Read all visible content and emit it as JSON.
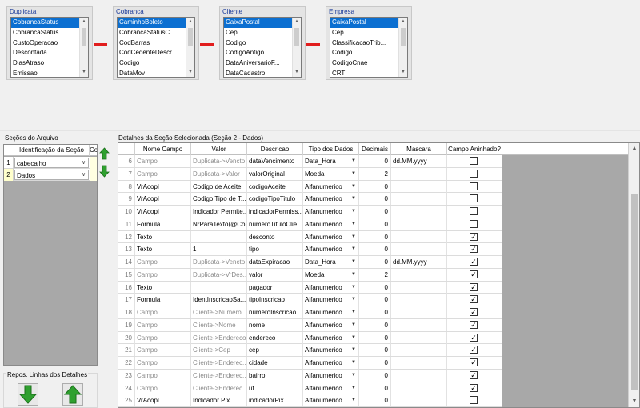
{
  "entities": [
    {
      "title": "Duplicata",
      "items": [
        "CobrancaStatus",
        "CobrancaStatus...",
        "CustoOperacao",
        "Descontada",
        "DiasAtraso",
        "Emissao"
      ]
    },
    {
      "title": "Cobranca",
      "items": [
        "CaminhoBoleto",
        "CobrancaStatusC...",
        "CodBarras",
        "CodCedenteDescr",
        "Codigo",
        "DataMov"
      ]
    },
    {
      "title": "Cliente",
      "items": [
        "CaixaPostal",
        "Cep",
        "Codigo",
        "CodigoAntigo",
        "DataAniversarioF...",
        "DataCadastro"
      ]
    },
    {
      "title": "Empresa",
      "items": [
        "CaixaPostal",
        "Cep",
        "ClassificacaoTrib...",
        "Codigo",
        "CodigoCnae",
        "CRT"
      ]
    }
  ],
  "sections": {
    "label": "Seções do Arquivo",
    "header": "Identificação da Seção",
    "header2": "Co",
    "rows": [
      {
        "num": "1",
        "value": "cabecalho"
      },
      {
        "num": "2",
        "value": "Dados"
      }
    ]
  },
  "repos": {
    "label": "Repos. Linhas dos Detalhes"
  },
  "details": {
    "label": "Detalhes da Seção Selecionada (Seção 2 - Dados)",
    "columns": [
      "Nome Campo",
      "Valor",
      "Descricao",
      "Tipo dos Dados",
      "Decimais",
      "Mascara",
      "Campo Aninhado?"
    ],
    "rows": [
      {
        "num": "6",
        "nome": "Campo",
        "valor": "Duplicata->Vencto",
        "descricao": "dataVencimento",
        "tipo": "Data_Hora",
        "decimais": "0",
        "mascara": "dd.MM.yyyy",
        "aninhado": false,
        "gray": true
      },
      {
        "num": "7",
        "nome": "Campo",
        "valor": "Duplicata->Valor",
        "descricao": "valorOriginal",
        "tipo": "Moeda",
        "decimais": "2",
        "mascara": "",
        "aninhado": false,
        "gray": true
      },
      {
        "num": "8",
        "nome": "VrAcopl",
        "valor": "Codigo de Aceite",
        "descricao": "codigoAceite",
        "tipo": "Alfanumerico",
        "decimais": "0",
        "mascara": "",
        "aninhado": false,
        "gray": false
      },
      {
        "num": "9",
        "nome": "VrAcopl",
        "valor": "Codigo Tipo de T...",
        "descricao": "codigoTipoTitulo",
        "tipo": "Alfanumerico",
        "decimais": "0",
        "mascara": "",
        "aninhado": false,
        "gray": false
      },
      {
        "num": "10",
        "nome": "VrAcopl",
        "valor": "Indicador Permite...",
        "descricao": "indicadorPermiss...",
        "tipo": "Alfanumerico",
        "decimais": "0",
        "mascara": "",
        "aninhado": false,
        "gray": false
      },
      {
        "num": "11",
        "nome": "Formula",
        "valor": "NrParaTexto(@Co...",
        "descricao": "numeroTituloClie...",
        "tipo": "Alfanumerico",
        "decimais": "0",
        "mascara": "",
        "aninhado": false,
        "gray": false
      },
      {
        "num": "12",
        "nome": "Texto",
        "valor": "",
        "descricao": "desconto",
        "tipo": "Alfanumerico",
        "decimais": "0",
        "mascara": "",
        "aninhado": true,
        "gray": false
      },
      {
        "num": "13",
        "nome": "Texto",
        "valor": "1",
        "descricao": "tipo",
        "tipo": "Alfanumerico",
        "decimais": "0",
        "mascara": "",
        "aninhado": true,
        "gray": false
      },
      {
        "num": "14",
        "nome": "Campo",
        "valor": "Duplicata->Vencto",
        "descricao": "dataExpiracao",
        "tipo": "Data_Hora",
        "decimais": "0",
        "mascara": "dd.MM.yyyy",
        "aninhado": true,
        "gray": true
      },
      {
        "num": "15",
        "nome": "Campo",
        "valor": "Duplicata->VrDes...",
        "descricao": "valor",
        "tipo": "Moeda",
        "decimais": "2",
        "mascara": "",
        "aninhado": true,
        "gray": true
      },
      {
        "num": "16",
        "nome": "Texto",
        "valor": "",
        "descricao": "pagador",
        "tipo": "Alfanumerico",
        "decimais": "0",
        "mascara": "",
        "aninhado": true,
        "gray": false
      },
      {
        "num": "17",
        "nome": "Formula",
        "valor": "IdentInscricaoSa...",
        "descricao": "tipoInscricao",
        "tipo": "Alfanumerico",
        "decimais": "0",
        "mascara": "",
        "aninhado": true,
        "gray": false
      },
      {
        "num": "18",
        "nome": "Campo",
        "valor": "Cliente->Numero...",
        "descricao": "numeroInscricao",
        "tipo": "Alfanumerico",
        "decimais": "0",
        "mascara": "",
        "aninhado": true,
        "gray": true
      },
      {
        "num": "19",
        "nome": "Campo",
        "valor": "Cliente->Nome",
        "descricao": "nome",
        "tipo": "Alfanumerico",
        "decimais": "0",
        "mascara": "",
        "aninhado": true,
        "gray": true
      },
      {
        "num": "20",
        "nome": "Campo",
        "valor": "Cliente->Endereco",
        "descricao": "endereco",
        "tipo": "Alfanumerico",
        "decimais": "0",
        "mascara": "",
        "aninhado": true,
        "gray": true
      },
      {
        "num": "21",
        "nome": "Campo",
        "valor": "Cliente->Cep",
        "descricao": "cep",
        "tipo": "Alfanumerico",
        "decimais": "0",
        "mascara": "",
        "aninhado": true,
        "gray": true
      },
      {
        "num": "22",
        "nome": "Campo",
        "valor": "Cliente->Enderec...",
        "descricao": "cidade",
        "tipo": "Alfanumerico",
        "decimais": "0",
        "mascara": "",
        "aninhado": true,
        "gray": true
      },
      {
        "num": "23",
        "nome": "Campo",
        "valor": "Cliente->Enderec...",
        "descricao": "bairro",
        "tipo": "Alfanumerico",
        "decimais": "0",
        "mascara": "",
        "aninhado": true,
        "gray": true
      },
      {
        "num": "24",
        "nome": "Campo",
        "valor": "Cliente->Enderec...",
        "descricao": "uf",
        "tipo": "Alfanumerico",
        "decimais": "0",
        "mascara": "",
        "aninhado": true,
        "gray": true
      },
      {
        "num": "25",
        "nome": "VrAcopl",
        "valor": "Indicador Pix",
        "descricao": "indicadorPix",
        "tipo": "Alfanumerico",
        "decimais": "0",
        "mascara": "",
        "aninhado": false,
        "gray": false
      }
    ]
  },
  "colors": {
    "selection": "#0b6fd1",
    "link": "#e11d1d",
    "green_arrow": "#2fa02f",
    "title_blue": "#1a3a9a"
  },
  "icons": [
    "arrow-down-green-icon",
    "arrow-up-green-icon",
    "checkbox-icon",
    "dropdown-arrow-icon"
  ]
}
